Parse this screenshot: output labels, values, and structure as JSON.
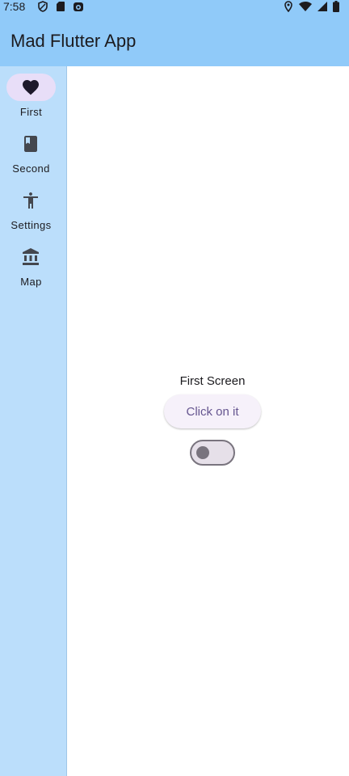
{
  "status_bar": {
    "time": "7:58",
    "left_icons": [
      "shield-icon",
      "sd-card-icon",
      "camera-icon"
    ],
    "right_icons": [
      "location-icon",
      "wifi-icon",
      "signal-icon",
      "battery-icon"
    ]
  },
  "app_bar": {
    "title": "Mad Flutter App",
    "background": "#90caf9"
  },
  "nav_rail": {
    "background": "#bbdefb",
    "indicator_color": "#e8def8",
    "items": [
      {
        "label": "First",
        "icon": "heart-icon",
        "selected": true
      },
      {
        "label": "Second",
        "icon": "book-icon",
        "selected": false
      },
      {
        "label": "Settings",
        "icon": "accessibility-icon",
        "selected": false
      },
      {
        "label": "Map",
        "icon": "bank-icon",
        "selected": false
      }
    ]
  },
  "main": {
    "title": "First Screen",
    "button_label": "Click on it",
    "toggle_on": false
  }
}
